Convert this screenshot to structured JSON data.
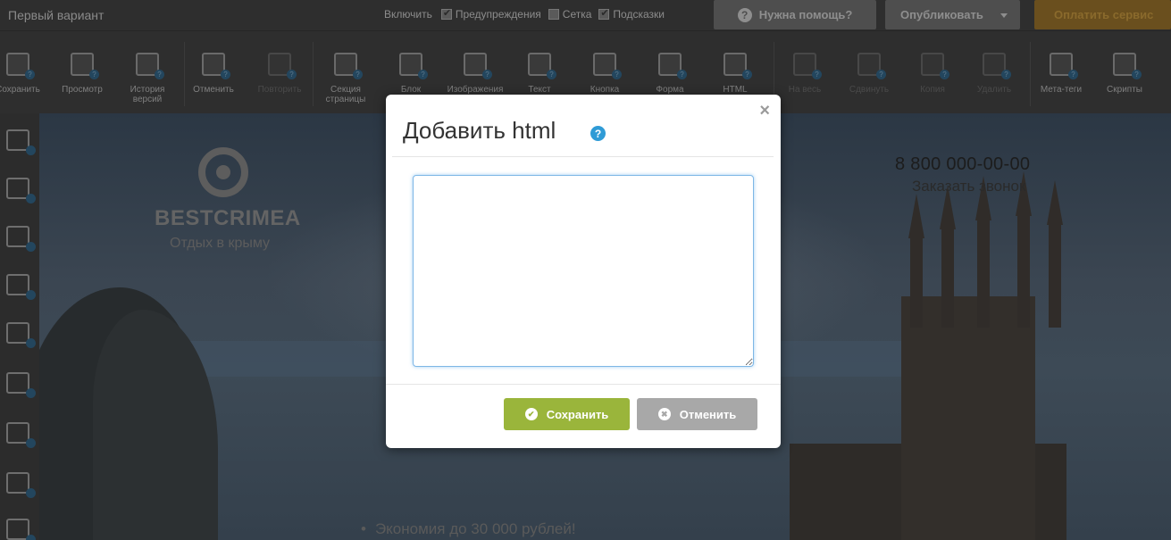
{
  "topbar": {
    "doc_title": "Первый вариант",
    "toggles_label": "Включить",
    "toggles": [
      {
        "label": "Предупреждения",
        "checked": true
      },
      {
        "label": "Сетка",
        "checked": false
      },
      {
        "label": "Подсказки",
        "checked": true
      }
    ],
    "help_label": "Нужна помощь?",
    "publish_label": "Опубликовать",
    "pay_label": "Оплатить сервис"
  },
  "toolbar": {
    "tools": [
      {
        "label": "Сохранить",
        "icon": "save-icon"
      },
      {
        "label": "Просмотр",
        "icon": "preview-icon"
      },
      {
        "label": "История версий",
        "icon": "history-icon"
      },
      {
        "label": "Отменить",
        "icon": "undo-icon"
      },
      {
        "label": "Повторить",
        "icon": "redo-icon"
      },
      {
        "label": "Секция страницы",
        "icon": "section-icon"
      },
      {
        "label": "Блок",
        "icon": "block-icon"
      },
      {
        "label": "Изображения",
        "icon": "image-icon"
      },
      {
        "label": "Текст",
        "icon": "text-icon"
      },
      {
        "label": "Кнопка",
        "icon": "button-icon"
      },
      {
        "label": "Форма",
        "icon": "form-icon"
      },
      {
        "label": "HTML",
        "icon": "html-icon"
      },
      {
        "label": "На весь",
        "icon": "fullwidth-icon"
      },
      {
        "label": "Сдвинуть",
        "icon": "shift-icon"
      },
      {
        "label": "Копия",
        "icon": "copy-icon"
      },
      {
        "label": "Удалить",
        "icon": "delete-icon"
      },
      {
        "label": "Мета-теги",
        "icon": "meta-tags-icon"
      },
      {
        "label": "Скрипты",
        "icon": "scripts-icon"
      }
    ]
  },
  "preview": {
    "brand": "BESTCRIMEA",
    "brand_sub": "Отдых в крыму",
    "phone": "8 800 000-00-00",
    "callback": "Заказать звонок",
    "bullet": "Экономия до 30 000 рублей!"
  },
  "modal": {
    "title": "Добавить html",
    "help": "?",
    "close": "×",
    "textarea_value": "",
    "save_label": "Сохранить",
    "cancel_label": "Отменить"
  }
}
